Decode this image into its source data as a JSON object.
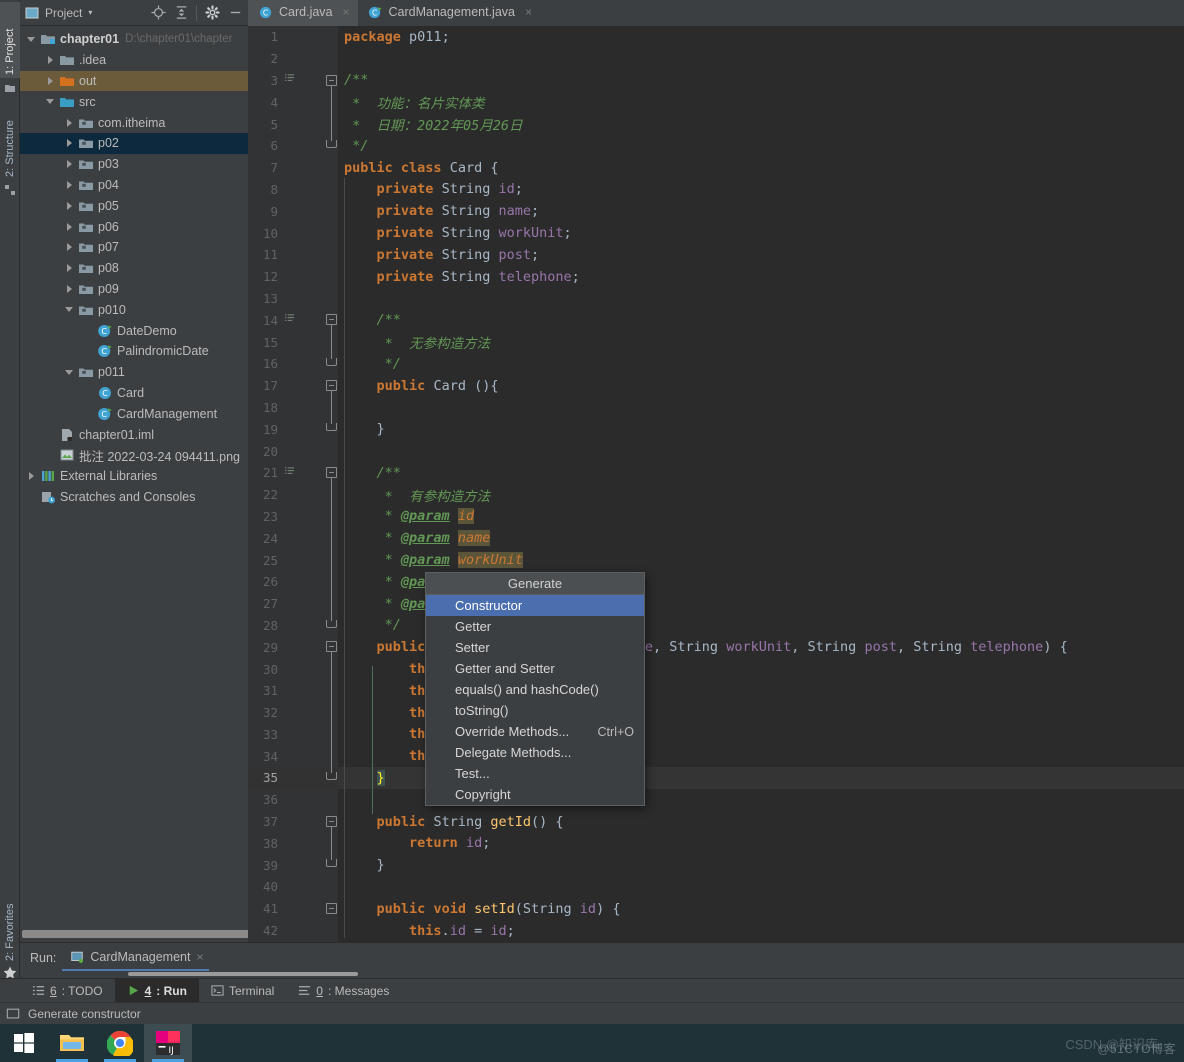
{
  "vertical_tabs": [
    {
      "label": "1: Project",
      "selected": true
    },
    {
      "label": "2: Structure",
      "selected": false
    },
    {
      "label": "2: Favorites",
      "selected": false
    }
  ],
  "project_panel": {
    "title": "Project",
    "caret": "▾",
    "tools": [
      "locate-icon",
      "collapse-all-icon",
      "settings-icon",
      "hide-icon"
    ],
    "tree": [
      {
        "indent": 0,
        "arrow": "open",
        "icon": "module-icon",
        "label": "chapter01",
        "bold": true,
        "sub": "D:\\chapter01\\chapter",
        "highlight": ""
      },
      {
        "indent": 1,
        "arrow": "closed",
        "icon": "folder-icon",
        "label": ".idea",
        "bold": false,
        "sub": "",
        "highlight": ""
      },
      {
        "indent": 1,
        "arrow": "closed",
        "icon": "folder-out-icon",
        "label": "out",
        "bold": false,
        "sub": "",
        "highlight": "brown"
      },
      {
        "indent": 1,
        "arrow": "open",
        "icon": "folder-src-icon",
        "label": "src",
        "bold": false,
        "sub": "",
        "highlight": ""
      },
      {
        "indent": 2,
        "arrow": "closed",
        "icon": "package-icon",
        "label": "com.itheima",
        "bold": false,
        "sub": "",
        "highlight": ""
      },
      {
        "indent": 2,
        "arrow": "closed",
        "icon": "package-icon",
        "label": "p02",
        "bold": false,
        "sub": "",
        "highlight": "blue"
      },
      {
        "indent": 2,
        "arrow": "closed",
        "icon": "package-icon",
        "label": "p03",
        "bold": false,
        "sub": "",
        "highlight": ""
      },
      {
        "indent": 2,
        "arrow": "closed",
        "icon": "package-icon",
        "label": "p04",
        "bold": false,
        "sub": "",
        "highlight": ""
      },
      {
        "indent": 2,
        "arrow": "closed",
        "icon": "package-icon",
        "label": "p05",
        "bold": false,
        "sub": "",
        "highlight": ""
      },
      {
        "indent": 2,
        "arrow": "closed",
        "icon": "package-icon",
        "label": "p06",
        "bold": false,
        "sub": "",
        "highlight": ""
      },
      {
        "indent": 2,
        "arrow": "closed",
        "icon": "package-icon",
        "label": "p07",
        "bold": false,
        "sub": "",
        "highlight": ""
      },
      {
        "indent": 2,
        "arrow": "closed",
        "icon": "package-icon",
        "label": "p08",
        "bold": false,
        "sub": "",
        "highlight": ""
      },
      {
        "indent": 2,
        "arrow": "closed",
        "icon": "package-icon",
        "label": "p09",
        "bold": false,
        "sub": "",
        "highlight": ""
      },
      {
        "indent": 2,
        "arrow": "open",
        "icon": "package-icon",
        "label": "p010",
        "bold": false,
        "sub": "",
        "highlight": ""
      },
      {
        "indent": 3,
        "arrow": "none",
        "icon": "class-run-icon",
        "label": "DateDemo",
        "bold": false,
        "sub": "",
        "highlight": ""
      },
      {
        "indent": 3,
        "arrow": "none",
        "icon": "class-run-icon",
        "label": "PalindromicDate",
        "bold": false,
        "sub": "",
        "highlight": ""
      },
      {
        "indent": 2,
        "arrow": "open",
        "icon": "package-icon",
        "label": "p011",
        "bold": false,
        "sub": "",
        "highlight": ""
      },
      {
        "indent": 3,
        "arrow": "none",
        "icon": "class-icon",
        "label": "Card",
        "bold": false,
        "sub": "",
        "highlight": ""
      },
      {
        "indent": 3,
        "arrow": "none",
        "icon": "class-run-icon",
        "label": "CardManagement",
        "bold": false,
        "sub": "",
        "highlight": ""
      },
      {
        "indent": 1,
        "arrow": "none",
        "icon": "iml-icon",
        "label": "chapter01.iml",
        "bold": false,
        "sub": "",
        "highlight": ""
      },
      {
        "indent": 1,
        "arrow": "none",
        "icon": "image-icon",
        "label": "批注 2022-03-24 094411.png",
        "bold": false,
        "sub": "",
        "highlight": ""
      },
      {
        "indent": 0,
        "arrow": "closed",
        "icon": "libraries-icon",
        "label": "External Libraries",
        "bold": false,
        "sub": "",
        "highlight": ""
      },
      {
        "indent": 0,
        "arrow": "none",
        "icon": "scratches-icon",
        "label": "Scratches and Consoles",
        "bold": false,
        "sub": "",
        "highlight": ""
      }
    ]
  },
  "editor": {
    "tabs": [
      {
        "label": "Card.java",
        "icon": "java-class-icon",
        "active": true,
        "close": "×"
      },
      {
        "label": "CardManagement.java",
        "icon": "java-class-run-icon",
        "active": false,
        "close": "×"
      }
    ],
    "lines": [
      {
        "n": "1",
        "text": "package p011;"
      },
      {
        "n": "2",
        "text": ""
      },
      {
        "n": "3",
        "text": "/**"
      },
      {
        "n": "4",
        "text": " *  功能：名片实体类"
      },
      {
        "n": "5",
        "text": " *  日期：2022年05月26日"
      },
      {
        "n": "6",
        "text": " */"
      },
      {
        "n": "7",
        "text": "public class Card {"
      },
      {
        "n": "8",
        "text": "    private String id;"
      },
      {
        "n": "9",
        "text": "    private String name;"
      },
      {
        "n": "10",
        "text": "    private String workUnit;"
      },
      {
        "n": "11",
        "text": "    private String post;"
      },
      {
        "n": "12",
        "text": "    private String telephone;"
      },
      {
        "n": "13",
        "text": ""
      },
      {
        "n": "14",
        "text": "    /**"
      },
      {
        "n": "15",
        "text": "     *  无参构造方法"
      },
      {
        "n": "16",
        "text": "     */"
      },
      {
        "n": "17",
        "text": "    public Card (){"
      },
      {
        "n": "18",
        "text": ""
      },
      {
        "n": "19",
        "text": "    }"
      },
      {
        "n": "20",
        "text": ""
      },
      {
        "n": "21",
        "text": "    /**"
      },
      {
        "n": "22",
        "text": "     *  有参构造方法"
      },
      {
        "n": "23",
        "text": "     * @param id"
      },
      {
        "n": "24",
        "text": "     * @param name"
      },
      {
        "n": "25",
        "text": "     * @param workUnit"
      },
      {
        "n": "26",
        "text": "     * @param post"
      },
      {
        "n": "27",
        "text": "     * @param telephone"
      },
      {
        "n": "28",
        "text": "     */"
      },
      {
        "n": "29",
        "text": "    public Card(String id, String name, String workUnit, String post, String telephone) {"
      },
      {
        "n": "30",
        "text": "        this.id = id;"
      },
      {
        "n": "31",
        "text": "        this.name = name;"
      },
      {
        "n": "32",
        "text": "        this.workUnit = workUnit;"
      },
      {
        "n": "33",
        "text": "        this.post = post;"
      },
      {
        "n": "34",
        "text": "        this.telephone = telephone;"
      },
      {
        "n": "35",
        "text": "    }"
      },
      {
        "n": "36",
        "text": ""
      },
      {
        "n": "37",
        "text": "    public String getId() {"
      },
      {
        "n": "38",
        "text": "        return id;"
      },
      {
        "n": "39",
        "text": "    }"
      },
      {
        "n": "40",
        "text": ""
      },
      {
        "n": "41",
        "text": "    public void setId(String id) {"
      },
      {
        "n": "42",
        "text": "        this.id = id;"
      }
    ]
  },
  "generate_popup": {
    "title": "Generate",
    "items": [
      {
        "label": "Constructor",
        "shortcut": "",
        "selected": true
      },
      {
        "label": "Getter",
        "shortcut": "",
        "selected": false
      },
      {
        "label": "Setter",
        "shortcut": "",
        "selected": false
      },
      {
        "label": "Getter and Setter",
        "shortcut": "",
        "selected": false
      },
      {
        "label": "equals() and hashCode()",
        "shortcut": "",
        "selected": false
      },
      {
        "label": "toString()",
        "shortcut": "",
        "selected": false
      },
      {
        "label": "Override Methods...",
        "shortcut": "Ctrl+O",
        "selected": false
      },
      {
        "label": "Delegate Methods...",
        "shortcut": "",
        "selected": false
      },
      {
        "label": "Test...",
        "shortcut": "",
        "selected": false
      },
      {
        "label": "Copyright",
        "shortcut": "",
        "selected": false
      }
    ]
  },
  "run_panel": {
    "label": "Run:",
    "tab_label": "CardManagement",
    "tab_icon": "run-config-icon",
    "close": "×"
  },
  "bottom_tabs": [
    {
      "num": "6",
      "label": ": TODO",
      "icon": "todo-icon",
      "active": false
    },
    {
      "num": "4",
      "label": ": Run",
      "icon": "play-icon",
      "active": true
    },
    {
      "num": "",
      "label": "Terminal",
      "icon": "terminal-icon",
      "active": false
    },
    {
      "num": "0",
      "label": ": Messages",
      "icon": "messages-icon",
      "active": false
    }
  ],
  "status_bar": {
    "icon": "popup-hint-icon",
    "text": "Generate constructor"
  },
  "taskbar": {
    "items": [
      {
        "name": "windows-start-icon",
        "active": false,
        "underline": false
      },
      {
        "name": "file-explorer-icon",
        "active": false,
        "underline": true
      },
      {
        "name": "chrome-icon",
        "active": false,
        "underline": true
      },
      {
        "name": "intellij-idea-icon",
        "active": true,
        "underline": true
      }
    ]
  },
  "watermarks": {
    "primary": "@51CTO博客",
    "secondary": "CSDN @知识库"
  },
  "colors": {
    "background": "#3c3f41",
    "editor_bg": "#2b2b2b",
    "gutter_bg": "#313335",
    "selection_blue": "#4b6eaf",
    "tree_select_blue": "#0d293e",
    "tree_select_brown": "#6b5b3a",
    "keyword": "#cc7832",
    "field": "#9876aa",
    "comment": "#629755",
    "method": "#ffc66d",
    "text": "#a9b7c6",
    "taskbar": "#1f3238"
  }
}
